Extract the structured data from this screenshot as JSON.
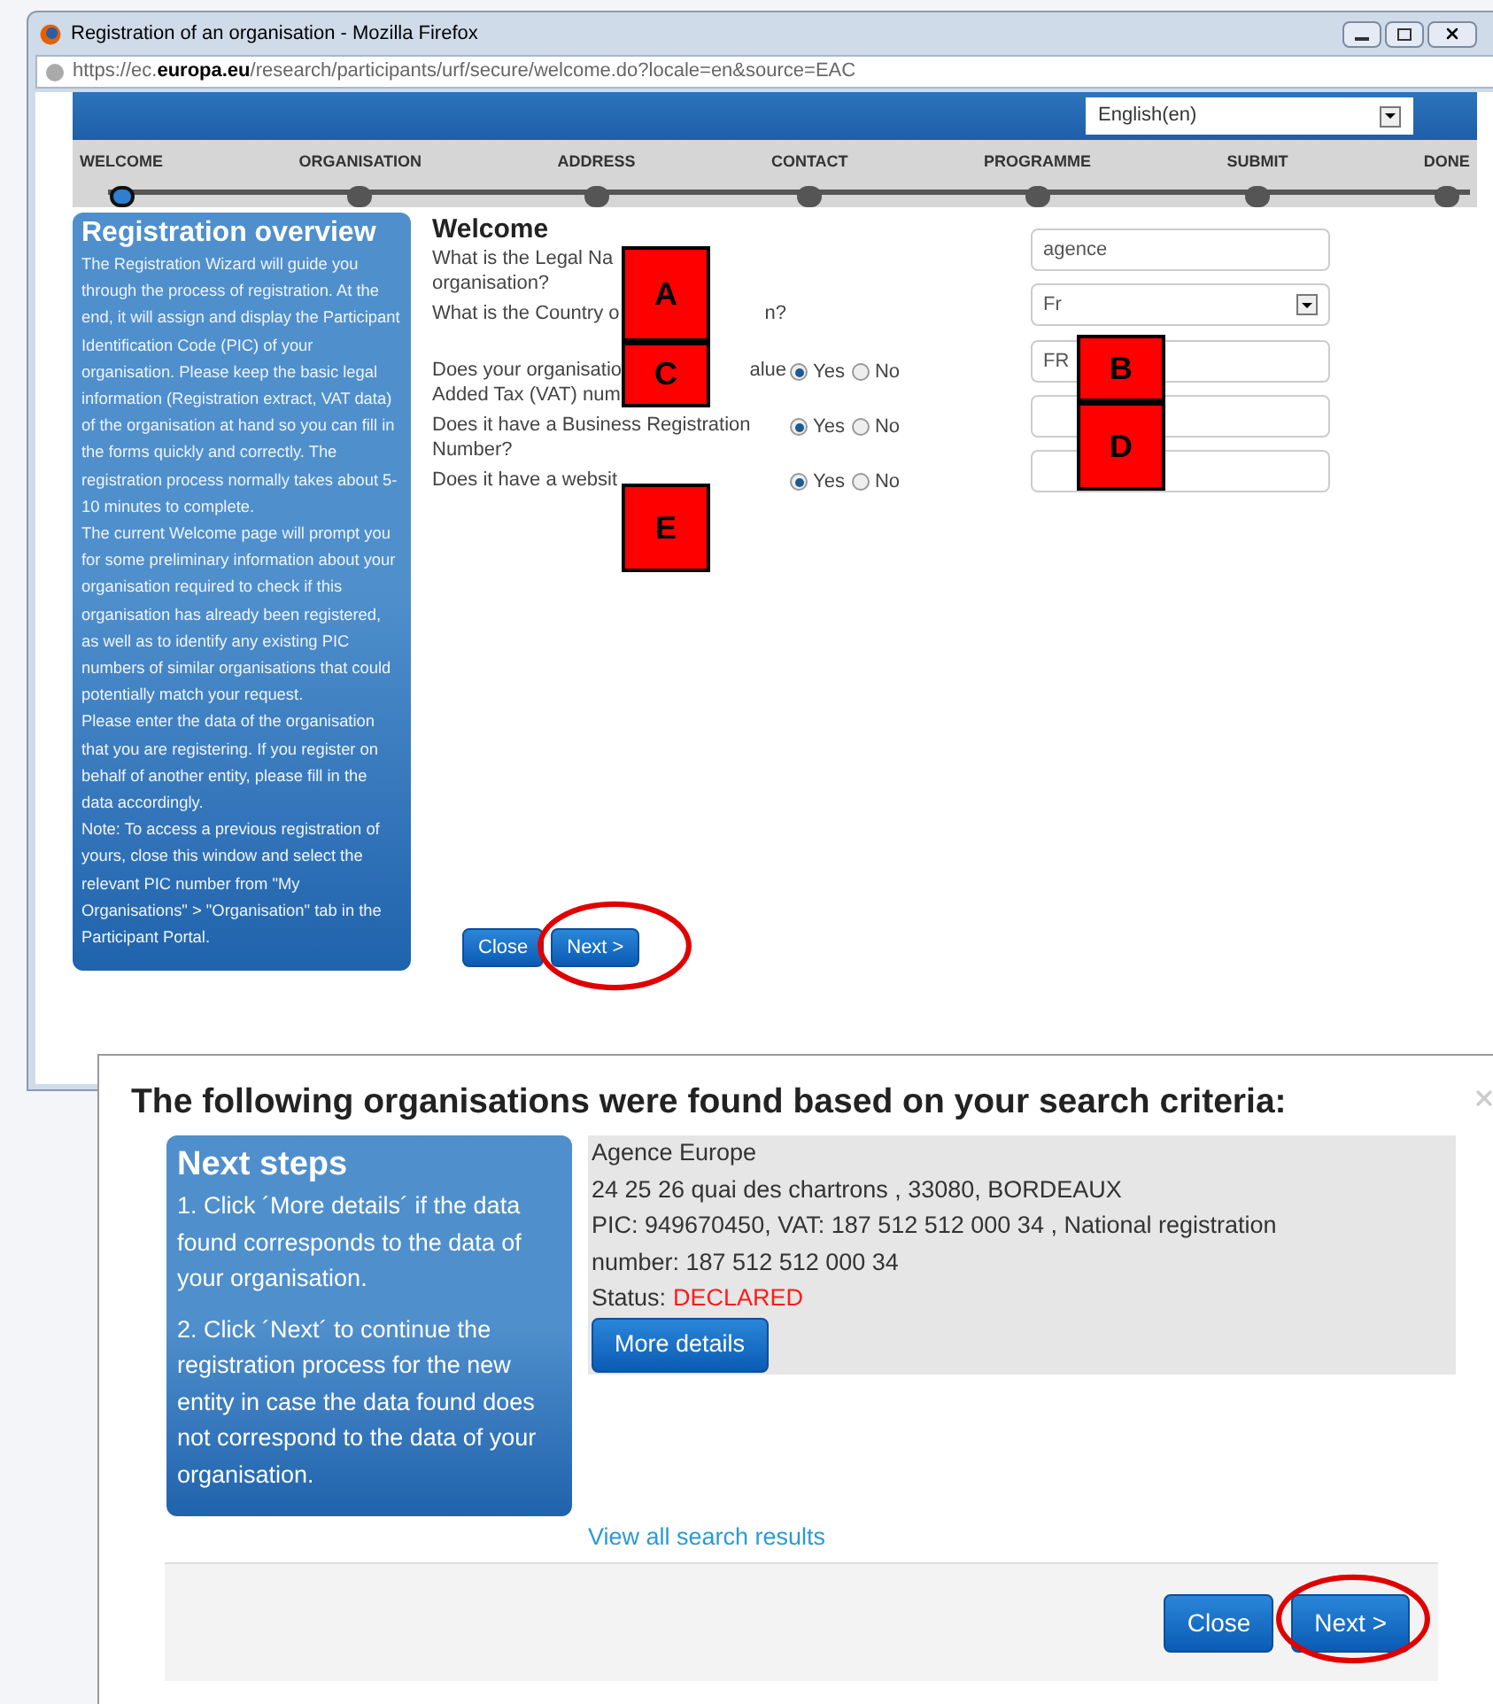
{
  "browser_window": {
    "title": "Registration of an organisation - Mozilla Firefox",
    "url": "https://ec.**europa.eu**/research/participants/urf/secure/welcome.do?locale=en&source=EAC"
  },
  "language_select": {
    "value": "English(en)"
  },
  "steps": [
    {
      "label": "WELCOME",
      "selected": true
    },
    {
      "label": "ORGANISATION",
      "selected": false
    },
    {
      "label": "ADDRESS",
      "selected": false
    },
    {
      "label": "CONTACT",
      "selected": false
    },
    {
      "label": "PROGRAMME",
      "selected": false
    },
    {
      "label": "SUBMIT",
      "selected": false
    },
    {
      "label": "DONE",
      "selected": false
    }
  ],
  "sidebar": {
    "title": "Registration overview",
    "paragraphs": [
      "The Registration Wizard will guide you through the process of registration. At the end, it will assign and display the Participant Identification Code (PIC) of your organisation. Please keep the basic legal information (Registration extract, VAT data) of the organisation at hand so you can fill in the forms quickly and correctly. The registration process normally takes about 5-10 minutes to complete.",
      "The current Welcome page will prompt you for some preliminary information about your organisation required to check if this organisation has already been registered, as well as to identify any existing PIC numbers of similar organisations that could potentially match your request.",
      "Please enter the data of the organisation that you are registering. If you register on behalf of another entity, please fill in the data accordingly.",
      "Note: To access a previous registration of yours, close this window and select the relevant PIC number from \"My Organisations\" > \"Organisation\" tab in the Participant Portal."
    ]
  },
  "form": {
    "title": "Welcome",
    "rows": [
      {
        "lines": [
          {
            "text": "What is the Legal Na"
          },
          {
            "text": "organisation?"
          }
        ],
        "field": {
          "kind": "input",
          "value": "agence"
        }
      },
      {
        "lines": [
          {
            "text": "What is the Country o",
            "after": "n?"
          }
        ],
        "field": {
          "kind": "select",
          "value": "Fr"
        }
      },
      {
        "lines": [
          {
            "text": "Does your organisatio",
            "after": "alue"
          },
          {
            "text": "Added Tax (VAT) num"
          }
        ],
        "radios": [
          {
            "label": "Yes",
            "selected": true
          },
          {
            "label": "No",
            "selected": false
          }
        ],
        "field": {
          "kind": "input",
          "value": "FR"
        }
      },
      {
        "lines": [
          {
            "text": "Does it have a Business Registration"
          },
          {
            "text": "Number?"
          }
        ],
        "radios": [
          {
            "label": "Yes",
            "selected": true
          },
          {
            "label": "No",
            "selected": false
          }
        ],
        "field": {
          "kind": "input"
        }
      },
      {
        "lines": [
          {
            "text": "Does it have a websit"
          }
        ],
        "radios": [
          {
            "label": "Yes",
            "selected": true
          },
          {
            "label": "No",
            "selected": false
          }
        ],
        "field": {
          "kind": "input"
        }
      }
    ],
    "buttons": [
      "Close",
      "Next >"
    ]
  },
  "annotation_markers": [
    {
      "label": "A"
    },
    {
      "label": "C"
    },
    {
      "label": "E"
    },
    {
      "label": "B"
    },
    {
      "label": "D"
    }
  ],
  "results_dialog": {
    "title": "The following organisations were found based on your search criteria:",
    "next_steps": {
      "title": "Next steps",
      "items": [
        "1. Click ´More details´ if the data found corresponds to the data of your organisation.",
        "2. Click ´Next´ to continue the registration process for the new entity in case the data found does not correspond to the data of your organisation."
      ]
    },
    "result": {
      "name": "Agence Europe",
      "address": "24 25 26 quai des chartrons , 33080, BORDEAUX",
      "identifiers": "PIC: 949670450, VAT: 187 512 512 000 34 , National registration number: 187 512 512 000 34",
      "status_label": "Status:",
      "status": "DECLARED",
      "button": "More details"
    },
    "link": "View all search results",
    "buttons": [
      "Close",
      "Next >"
    ]
  }
}
